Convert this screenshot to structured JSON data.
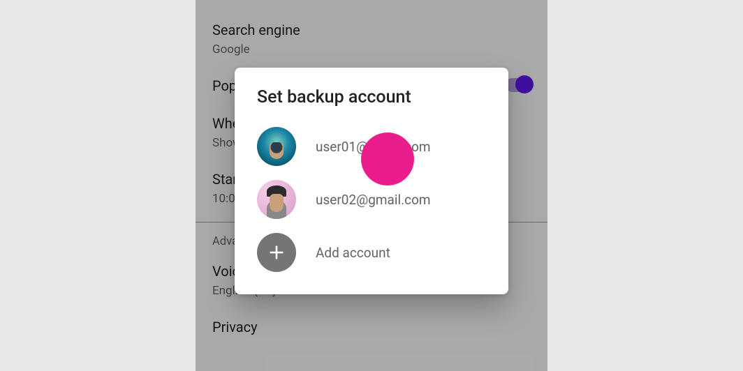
{
  "settings": {
    "search_engine": {
      "title": "Search engine",
      "subtitle": "Google"
    },
    "popup": {
      "title": "Popup"
    },
    "when_started": {
      "title": "When started",
      "subtitle": "Show homepage"
    },
    "start_time": {
      "title": "Start time",
      "subtitle": "10:00"
    },
    "advanced_header": "Advanced",
    "voice_search": {
      "title": "Voice search",
      "subtitle": "English (US)"
    },
    "privacy": {
      "title": "Privacy"
    }
  },
  "dialog": {
    "title": "Set backup account",
    "accounts": [
      {
        "email": "user01@gmail.com"
      },
      {
        "email": "user02@gmail.com"
      }
    ],
    "add_label": "Add account"
  },
  "colors": {
    "touch_indicator": "#e91e8c",
    "switch_thumb": "#5e17eb"
  }
}
